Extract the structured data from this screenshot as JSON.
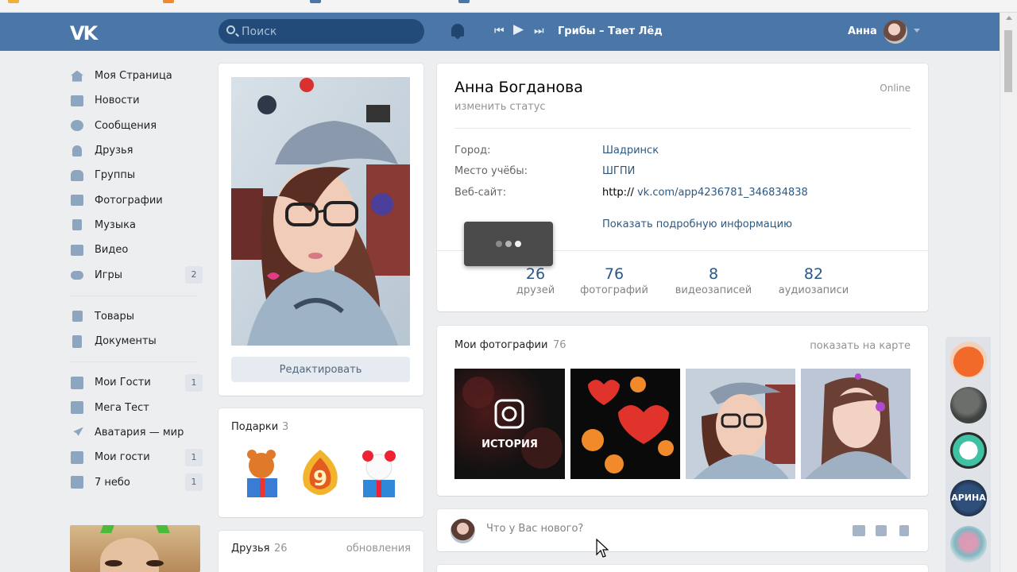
{
  "header": {
    "logo": "VK",
    "search_placeholder": "Поиск",
    "track": "Грибы – Тает Лёд",
    "user_name": "Анна"
  },
  "menu": {
    "items": [
      {
        "label": "Моя Страница",
        "icon": "home-icon"
      },
      {
        "label": "Новости",
        "icon": "news-icon"
      },
      {
        "label": "Сообщения",
        "icon": "messages-icon"
      },
      {
        "label": "Друзья",
        "icon": "friends-icon"
      },
      {
        "label": "Группы",
        "icon": "groups-icon"
      },
      {
        "label": "Фотографии",
        "icon": "camera-icon"
      },
      {
        "label": "Музыка",
        "icon": "music-icon"
      },
      {
        "label": "Видео",
        "icon": "video-icon"
      },
      {
        "label": "Игры",
        "icon": "gamepad-icon",
        "count": "2"
      }
    ],
    "items2": [
      {
        "label": "Товары",
        "icon": "bag-icon"
      },
      {
        "label": "Документы",
        "icon": "document-icon"
      }
    ],
    "apps": [
      {
        "label": "Мои Гости",
        "icon": "app-grid-icon",
        "count": "1"
      },
      {
        "label": "Мега Тест",
        "icon": "app-grid-icon"
      },
      {
        "label": "Аватария — мир",
        "icon": "rocket-icon"
      },
      {
        "label": "Мои гости",
        "icon": "app-grid-icon",
        "count": "1"
      },
      {
        "label": "7 небо",
        "icon": "app-grid-icon",
        "count": "1"
      }
    ]
  },
  "photo_card": {
    "edit_label": "Редактировать"
  },
  "gifts": {
    "title": "Подарки",
    "count": "3"
  },
  "friends": {
    "title": "Друзья",
    "count": "26",
    "updates": "обновления"
  },
  "profile": {
    "name": "Анна Богданова",
    "online": "Online",
    "status": "изменить статус",
    "rows": [
      {
        "label": "Город:",
        "value": "Шадринск"
      },
      {
        "label": "Место учёбы:",
        "value": "ШГПИ"
      },
      {
        "label": "Веб-сайт:",
        "prefix": "http://",
        "value": "vk.com/app4236781_346834838"
      }
    ],
    "more_info": "Показать подробную информацию",
    "counters": [
      {
        "num": "26",
        "label": "друзей"
      },
      {
        "num": "76",
        "label": "фотографий"
      },
      {
        "num": "8",
        "label": "видеозаписей"
      },
      {
        "num": "82",
        "label": "аудиозаписи"
      }
    ]
  },
  "photos": {
    "title": "Мои фотографии",
    "count": "76",
    "map_link": "показать на карте",
    "story_label": "ИСТОРИЯ"
  },
  "post": {
    "placeholder": "Что у Вас нового?"
  },
  "right_bar": {
    "avatar3_text": "АРИНА"
  },
  "colors": {
    "header": "#4a76a8",
    "link": "#2a5885",
    "background": "#edeef0"
  }
}
